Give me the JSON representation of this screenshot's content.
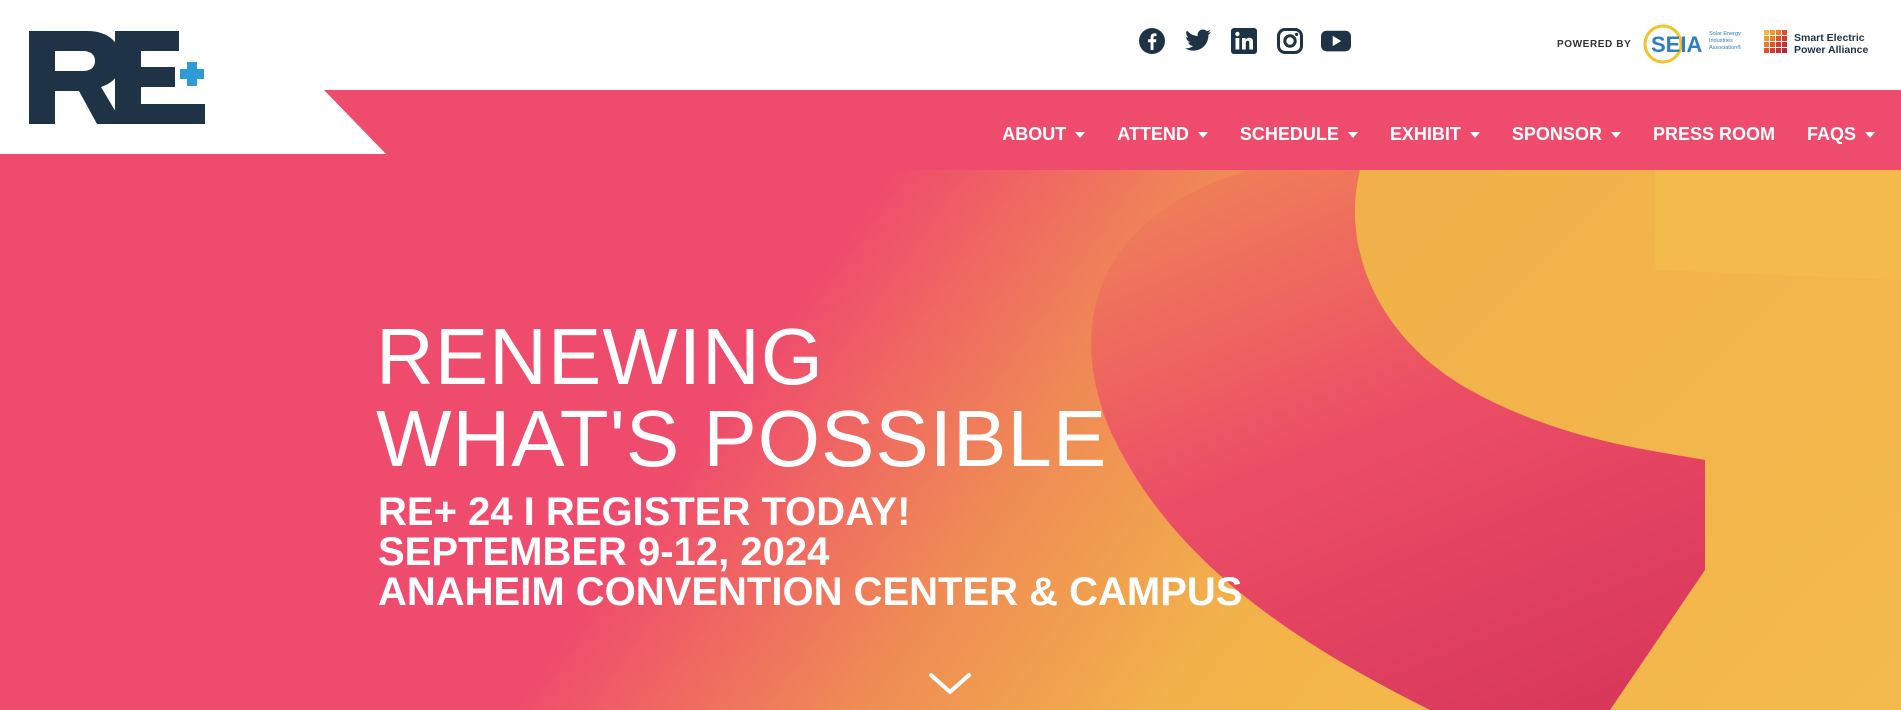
{
  "header": {
    "logo_alt": "RE+",
    "social": [
      {
        "name": "facebook-icon"
      },
      {
        "name": "twitter-icon"
      },
      {
        "name": "linkedin-icon"
      },
      {
        "name": "instagram-icon"
      },
      {
        "name": "youtube-icon"
      }
    ],
    "powered_by": "POWERED BY",
    "seia": {
      "mark": "SEIA",
      "text": "Solar Energy Industries Association®"
    },
    "sepa": {
      "line1": "Smart Electric",
      "line2": "Power Alliance"
    }
  },
  "nav": {
    "items": [
      {
        "label": "ABOUT",
        "dropdown": true
      },
      {
        "label": "ATTEND",
        "dropdown": true
      },
      {
        "label": "SCHEDULE",
        "dropdown": true
      },
      {
        "label": "EXHIBIT",
        "dropdown": true
      },
      {
        "label": "SPONSOR",
        "dropdown": true
      },
      {
        "label": "PRESS ROOM",
        "dropdown": false
      },
      {
        "label": "FAQS",
        "dropdown": true
      }
    ]
  },
  "hero": {
    "headline_line1": "RENEWING",
    "headline_line2": "WHAT'S POSSIBLE",
    "sub_line1": "RE+ 24 I REGISTER TODAY!",
    "sub_line2": "SEPTEMBER 9-12, 2024",
    "sub_line3": "ANAHEIM CONVENTION CENTER & CAMPUS"
  },
  "colors": {
    "brand_pink": "#ef4b6c",
    "brand_orange": "#f2b24a",
    "navy": "#1e3345",
    "plus_blue": "#2f9bd6"
  }
}
